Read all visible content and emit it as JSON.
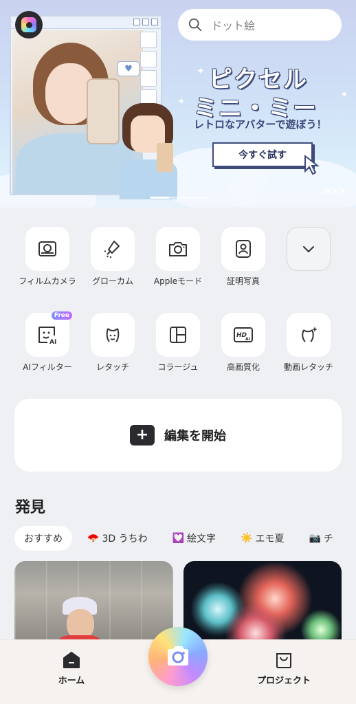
{
  "search": {
    "placeholder": "ドット絵"
  },
  "banner": {
    "title_line1": "ピクセル",
    "title_line2": "ミニ・ミー",
    "subtitle": "レトロなアバターで遊ぼう！",
    "cta": "今すぐ試す",
    "arrows": ">>>"
  },
  "tools": {
    "row1": [
      {
        "label": "フィルムカメラ",
        "icon": "film-camera-icon"
      },
      {
        "label": "グローカム",
        "icon": "glow-lamp-icon"
      },
      {
        "label": "Appleモード",
        "icon": "camera-icon"
      },
      {
        "label": "証明写真",
        "icon": "id-photo-icon"
      },
      {
        "label": "",
        "icon": "chevron-down-icon"
      }
    ],
    "row2": [
      {
        "label": "AIフィルター",
        "icon": "ai-face-icon",
        "badge": "Free"
      },
      {
        "label": "レタッチ",
        "icon": "retouch-face-icon"
      },
      {
        "label": "コラージュ",
        "icon": "collage-icon"
      },
      {
        "label": "高画質化",
        "icon": "hd-ai-icon"
      },
      {
        "label": "動画レタッチ",
        "icon": "video-retouch-icon"
      }
    ]
  },
  "edit": {
    "label": "編集を開始",
    "icon": "plus-icon"
  },
  "discover": {
    "title": "発見",
    "chips": [
      {
        "label": "おすすめ",
        "icon": ""
      },
      {
        "label": "3D うちわ",
        "icon": "🪭"
      },
      {
        "label": "絵文字",
        "icon": "💟"
      },
      {
        "label": "エモ夏",
        "icon": "☀️"
      },
      {
        "label": "チ",
        "icon": "📷"
      }
    ]
  },
  "nav": {
    "home": "ホーム",
    "projects": "プロジェクト"
  },
  "colors": {
    "background": "#eef0f3",
    "cta_border": "#3e4a7a",
    "free_badge": "#a07bff"
  }
}
